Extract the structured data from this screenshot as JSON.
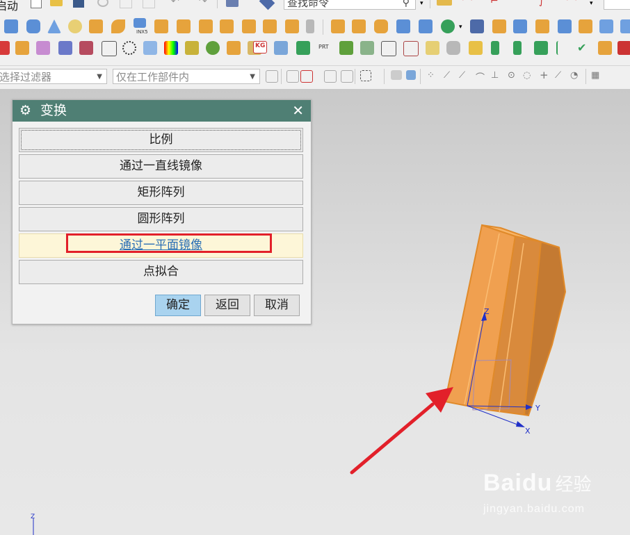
{
  "toolbar": {
    "top_left_fragment": "启动",
    "command_search_value": "查找命令",
    "selection_filter_value": "选择过滤器",
    "scope_filter_value": "仅在工作部件内",
    "icon_label_inx5": "INX5",
    "icon_label_kg": "KG",
    "icon_label_prt": "PRT"
  },
  "dialog": {
    "title": "变换",
    "options": [
      "比例",
      "通过一直线镜像",
      "矩形阵列",
      "圆形阵列",
      "通过一平面镜像",
      "点拟合"
    ],
    "highlighted_option": "通过一平面镜像",
    "buttons": {
      "ok": "确定",
      "back": "返回",
      "cancel": "取消"
    }
  },
  "viewport": {
    "axis_labels": {
      "z": "Z",
      "y": "Y",
      "x": "X"
    },
    "corner_axis_label": "Z",
    "model_color": "#f0a050"
  },
  "annotation": {
    "arrow_color": "#e2202a",
    "box_color": "#e2202a"
  },
  "watermark": {
    "brand": "Baidu",
    "product": "经验",
    "url": "jingyan.baidu.com"
  }
}
